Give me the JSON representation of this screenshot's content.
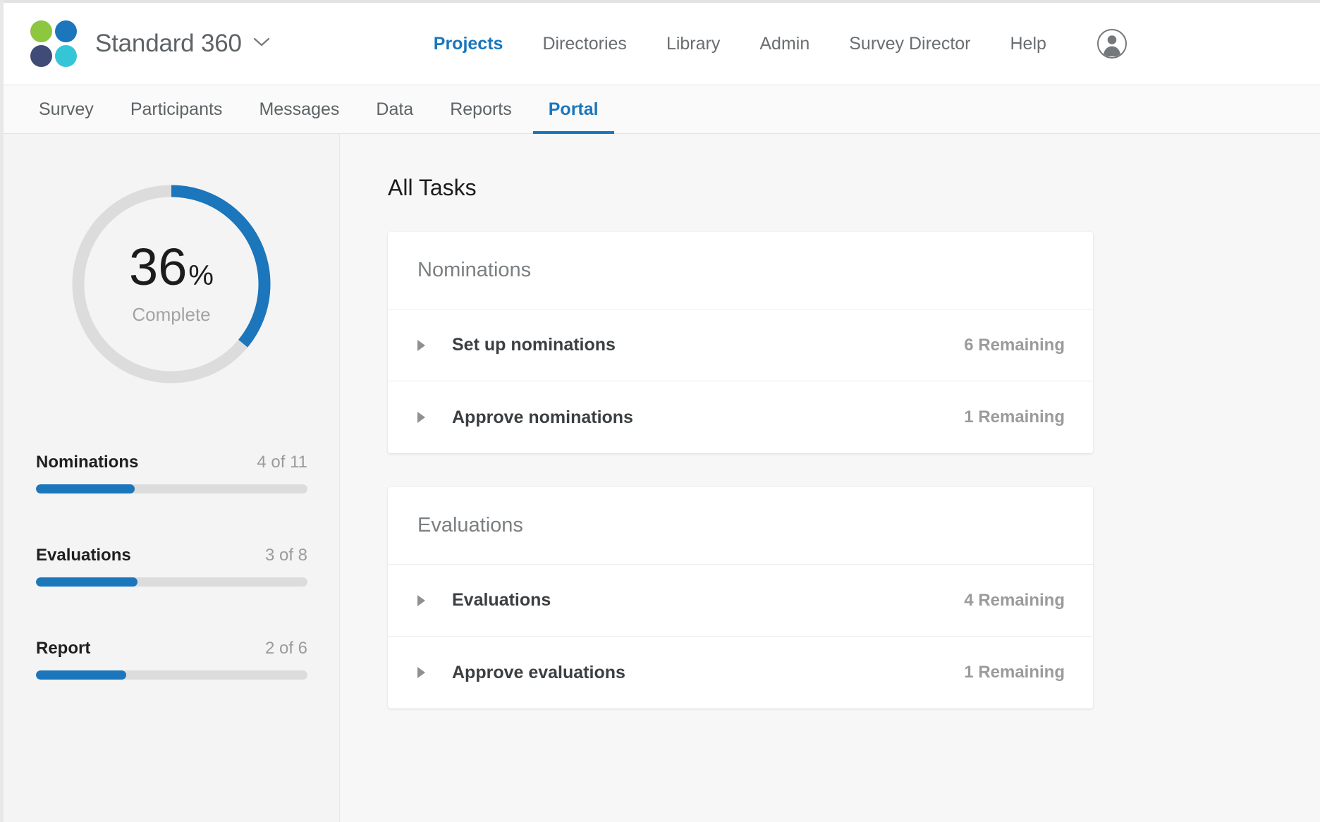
{
  "brand": {
    "title": "Standard 360",
    "caret": "chevron-down-icon",
    "logo_colors": [
      "#8dc63f",
      "#1b76bc",
      "#414b78",
      "#34c6d7"
    ]
  },
  "top_nav": {
    "items": [
      {
        "label": "Projects",
        "active": true
      },
      {
        "label": "Directories",
        "active": false
      },
      {
        "label": "Library",
        "active": false
      },
      {
        "label": "Admin",
        "active": false
      },
      {
        "label": "Survey Director",
        "active": false
      },
      {
        "label": "Help",
        "active": false
      }
    ],
    "avatar_icon": "user-avatar-icon"
  },
  "tabs": {
    "items": [
      {
        "label": "Survey",
        "active": false
      },
      {
        "label": "Participants",
        "active": false
      },
      {
        "label": "Messages",
        "active": false
      },
      {
        "label": "Data",
        "active": false
      },
      {
        "label": "Reports",
        "active": false
      },
      {
        "label": "Portal",
        "active": true
      }
    ]
  },
  "sidebar": {
    "progress": {
      "percent": "36",
      "percent_symbol": "%",
      "label": "Complete"
    },
    "metrics": [
      {
        "name": "Nominations",
        "count": "4 of 11",
        "done": 4,
        "total": 11
      },
      {
        "name": "Evaluations",
        "count": "3 of 8",
        "done": 3,
        "total": 8
      },
      {
        "name": "Report",
        "count": "2 of 6",
        "done": 2,
        "total": 6
      }
    ]
  },
  "main": {
    "title": "All Tasks",
    "cards": [
      {
        "header": "Nominations",
        "rows": [
          {
            "name": "Set up nominations",
            "remaining": "6 Remaining"
          },
          {
            "name": "Approve nominations",
            "remaining": "1 Remaining"
          }
        ]
      },
      {
        "header": "Evaluations",
        "rows": [
          {
            "name": "Evaluations",
            "remaining": "4 Remaining"
          },
          {
            "name": "Approve evaluations",
            "remaining": "1 Remaining"
          }
        ]
      }
    ]
  },
  "chart_data": {
    "type": "pie",
    "title": "Overall completion",
    "categories": [
      "Complete",
      "Remaining"
    ],
    "values": [
      36,
      64
    ],
    "unit": "%",
    "center_label": "36% Complete",
    "colors": [
      "#1b76bc",
      "#dcdcdc"
    ],
    "legend": "none"
  },
  "theme": {
    "accent": "#1b76bc",
    "track": "#dcdcdc",
    "text_dark": "#1c1c1c",
    "text_muted": "#9b9b9b"
  }
}
